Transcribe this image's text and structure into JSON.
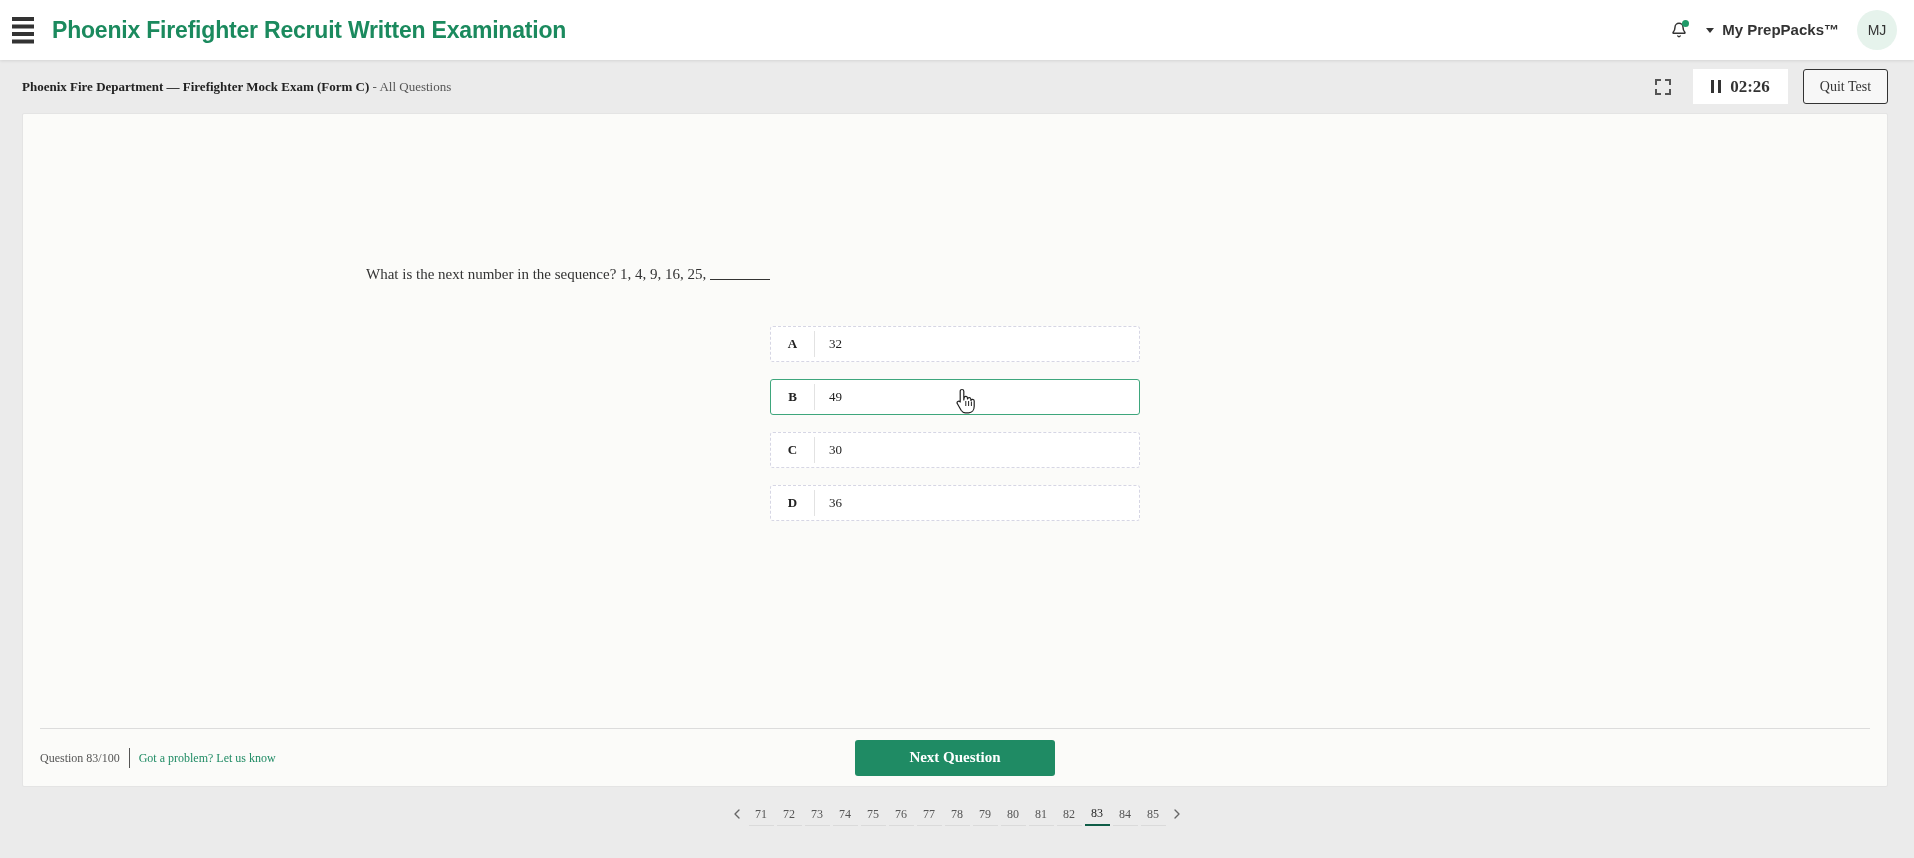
{
  "header": {
    "title": "Phoenix Firefighter Recruit Written Examination",
    "has_notifications": true,
    "account_menu": "My PrepPacks™",
    "avatar_initials": "MJ"
  },
  "exam_bar": {
    "breadcrumb": "**Phoenix Fire Department — Firefighter Mock Exam (Form C)** - All Questions",
    "timer": "02:26",
    "quit_button": "Quit Test"
  },
  "question": {
    "text": "What is the next number in the sequence? 1, 4, 9, 16, 25,",
    "options": [
      {
        "letter": "A",
        "text": "32",
        "selected": false
      },
      {
        "letter": "B",
        "text": "49",
        "selected": true
      },
      {
        "letter": "C",
        "text": "30",
        "selected": false
      },
      {
        "letter": "D",
        "text": "36",
        "selected": false
      }
    ]
  },
  "footer": {
    "question_counter": "Question 83/100",
    "report_link": "Got a problem? Let us know",
    "next_button": "Next Question"
  },
  "pagination": {
    "pages": [
      {
        "label": "71",
        "selected": false
      },
      {
        "label": "72",
        "selected": false
      },
      {
        "label": "73",
        "selected": false
      },
      {
        "label": "74",
        "selected": false
      },
      {
        "label": "75",
        "selected": false
      },
      {
        "label": "76",
        "selected": false
      },
      {
        "label": "77",
        "selected": false
      },
      {
        "label": "78",
        "selected": false
      },
      {
        "label": "79",
        "selected": false
      },
      {
        "label": "80",
        "selected": false
      },
      {
        "label": "81",
        "selected": false
      },
      {
        "label": "82",
        "selected": false
      },
      {
        "label": "83",
        "selected": true
      },
      {
        "label": "84",
        "selected": false
      },
      {
        "label": "85",
        "selected": false
      }
    ]
  }
}
